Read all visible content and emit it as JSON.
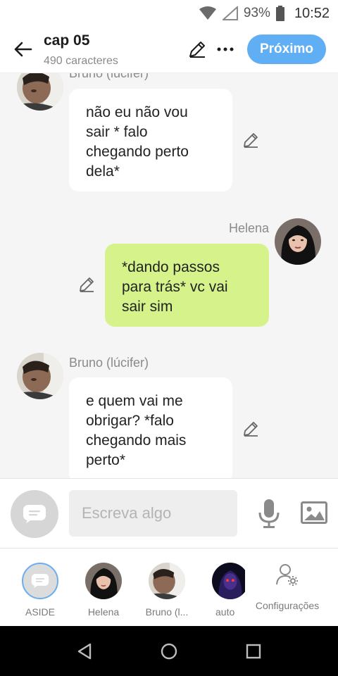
{
  "status_bar": {
    "battery": "93%",
    "time": "10:52"
  },
  "header": {
    "title": "cap 05",
    "subtitle": "490 caracteres",
    "next_label": "Próximo"
  },
  "messages": [
    {
      "author": "Bruno (lúcifer)",
      "side": "left",
      "text": "não eu não vou sair * falo chegando perto dela*"
    },
    {
      "author": "Helena",
      "side": "right",
      "text": "*dando passos para trás* vc vai sair sim"
    },
    {
      "author": "Bruno (lúcifer)",
      "side": "left",
      "text": "e quem vai me obrigar? *falo chegando mais perto*"
    }
  ],
  "composer": {
    "placeholder": "Escreva algo"
  },
  "characters": [
    {
      "label": "ASIDE"
    },
    {
      "label": "Helena"
    },
    {
      "label": "Bruno (l..."
    },
    {
      "label": "auto"
    }
  ],
  "settings": {
    "label": "Configurações"
  },
  "colors": {
    "accent": "#60aef4",
    "bubble_green": "#d5f38a",
    "bubble_white": "#ffffff",
    "chat_bg": "#f5f5f5"
  }
}
